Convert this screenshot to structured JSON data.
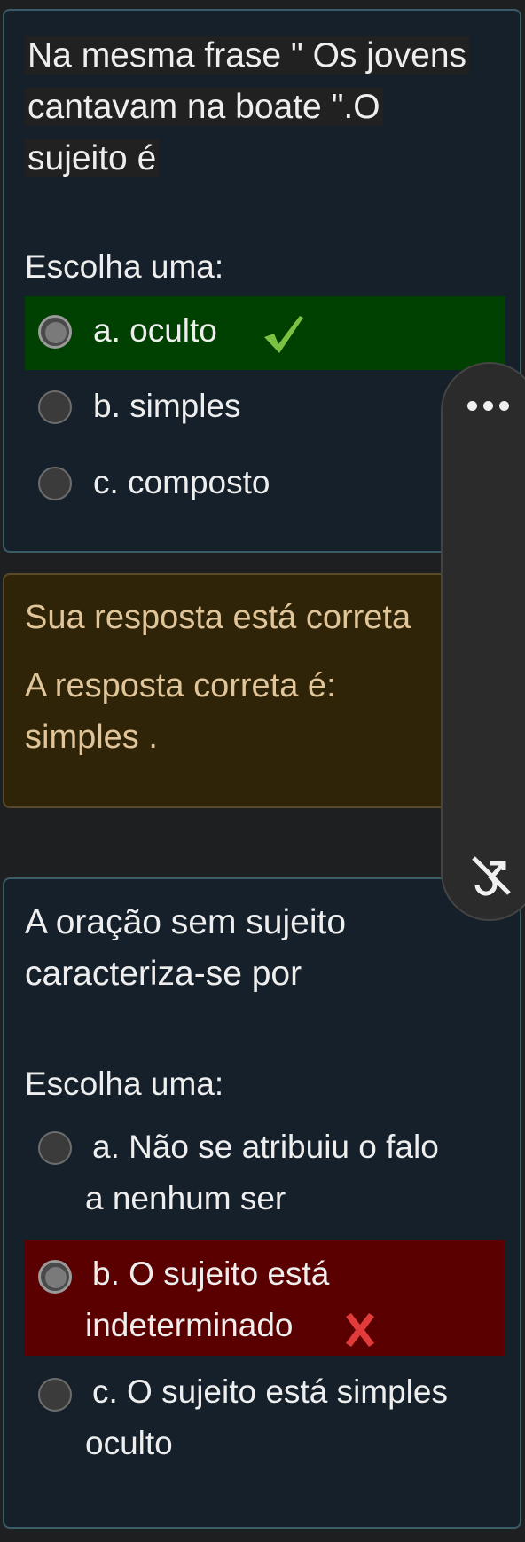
{
  "question1": {
    "text_lines": [
      "Na mesma frase \" Os jovens",
      "cantavam na boate  \".O",
      "sujeito é"
    ],
    "choose_label": "Escolha uma:",
    "options": [
      {
        "label": "a. oculto",
        "state": "selected-correct"
      },
      {
        "label": "b. simples",
        "state": "unselected"
      },
      {
        "label": "c. composto",
        "state": "unselected"
      }
    ]
  },
  "feedback1": {
    "result": "Sua resposta está correta",
    "correct_label": "A resposta correta é:",
    "correct_value": "simples ."
  },
  "question2": {
    "text_lines": [
      "A oração sem sujeito",
      "caracteriza-se por"
    ],
    "choose_label": "Escolha uma:",
    "options": [
      {
        "line1": "a. Não se atribuiu o falo",
        "line2": "a nenhum ser",
        "state": "unselected"
      },
      {
        "line1": "b. O sujeito está",
        "line2": "indeterminado",
        "state": "selected-wrong"
      },
      {
        "line1": "c. O sujeito está simples",
        "line2": "oculto",
        "state": "unselected"
      }
    ]
  },
  "colors": {
    "correct_bg": "#004000",
    "wrong_bg": "#5b0000",
    "check": "#7cc142",
    "cross": "#e23b3b",
    "feedback_text": "#e1c59a"
  },
  "icons": [
    "check-icon",
    "cross-icon",
    "more-dots-icon",
    "hide-overlay-icon"
  ]
}
